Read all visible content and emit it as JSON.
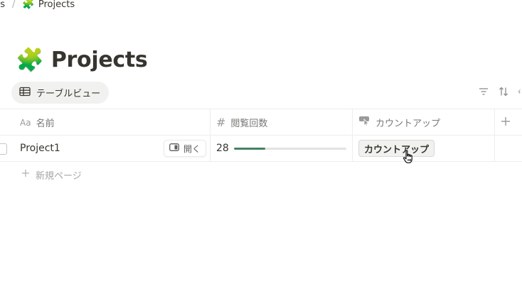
{
  "breadcrumb": {
    "parent": "cts",
    "separator": "/",
    "current_emoji": "🧩",
    "current": "Projects"
  },
  "page": {
    "emoji": "🧩",
    "title": "Projects"
  },
  "view_tab": {
    "label": "テーブルビュー",
    "icon": "table-icon"
  },
  "toolbar": {
    "icons": [
      "filter-icon",
      "sort-icon",
      "lightning-icon"
    ]
  },
  "table": {
    "columns": [
      {
        "icon": "text-aa-icon",
        "icon_text": "Aa",
        "label": "名前"
      },
      {
        "icon": "hash-icon",
        "icon_text": "#",
        "label": "閲覧回数"
      },
      {
        "icon": "button-cursor-icon",
        "label": "カウントアップ"
      }
    ],
    "add_column_icon": "plus-icon",
    "rows": [
      {
        "name": "Project1",
        "open_label": "開く",
        "views": "28",
        "views_progress": 0.28,
        "button_label": "カウントアップ"
      }
    ],
    "new_page_label": "新規ページ"
  },
  "colors": {
    "text": "#37352f",
    "muted": "#787774",
    "border": "#ededeb",
    "progress": "#448361",
    "tab_bg": "#f1f1ef"
  }
}
